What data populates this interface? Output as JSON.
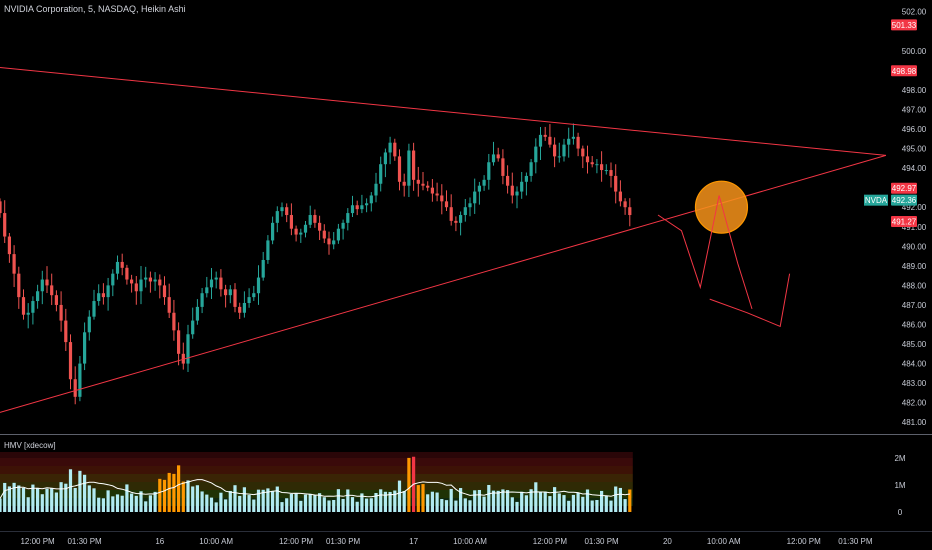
{
  "header": {
    "symbol_line": "NVIDIA Corporation, 5, NASDAQ, Heikin Ashi"
  },
  "indicator": {
    "label": "HMV [xdecow]"
  },
  "colors": {
    "up": "#26a69a",
    "down": "#ef5350",
    "line": "#f23645",
    "circle_fill": "#f7931a",
    "vol_light": "#b2ebf2",
    "vol_hot": "#ff9800",
    "vol_extreme": "#f23645",
    "avg_line": "#ffffff",
    "background": "#000000"
  },
  "chart_data": {
    "type": "candlestick",
    "symbol": "NVDA",
    "ylim": [
      480.5,
      502.6
    ],
    "y_ticks": [
      481,
      482,
      483,
      484,
      485,
      486,
      487,
      488,
      489,
      490,
      491,
      492,
      494,
      495,
      496,
      497,
      498,
      500,
      502
    ],
    "y_tick_labels": [
      "481.00",
      "482.00",
      "483.00",
      "484.00",
      "485.00",
      "486.00",
      "487.00",
      "488.00",
      "489.00",
      "490.00",
      "491.00",
      "492.00",
      "494.00",
      "495.00",
      "496.00",
      "497.00",
      "498.00",
      "500.00",
      "502.00"
    ],
    "price_tags": [
      {
        "label": "501.33",
        "value": 501.33,
        "color": "#f23645"
      },
      {
        "label": "498.98",
        "value": 498.98,
        "color": "#f23645"
      },
      {
        "label": "492.97",
        "value": 492.97,
        "color": "#f23645"
      },
      {
        "label": "492.36",
        "value": 492.36,
        "color": "#26a69a",
        "symbol_tag": "NVDA"
      },
      {
        "label": "491.27",
        "value": 491.27,
        "color": "#f23645"
      }
    ],
    "x_ticks": [
      {
        "label": "12:00 PM",
        "bar": 8
      },
      {
        "label": "01:30 PM",
        "bar": 18
      },
      {
        "label": "16",
        "bar": 34
      },
      {
        "label": "10:00 AM",
        "bar": 46
      },
      {
        "label": "12:00 PM",
        "bar": 63
      },
      {
        "label": "01:30 PM",
        "bar": 73
      },
      {
        "label": "17",
        "bar": 88
      },
      {
        "label": "10:00 AM",
        "bar": 100
      },
      {
        "label": "12:00 PM",
        "bar": 117
      },
      {
        "label": "01:30 PM",
        "bar": 128
      },
      {
        "label": "20",
        "bar": 142
      },
      {
        "label": "10:00 AM",
        "bar": 154
      },
      {
        "label": "12:00 PM",
        "bar": 171
      },
      {
        "label": "01:30 PM",
        "bar": 182
      }
    ],
    "closes": [
      491.7,
      490.5,
      489.6,
      488.6,
      487.4,
      486.5,
      486.6,
      487.2,
      487.7,
      488.3,
      488.0,
      487.5,
      487.0,
      486.2,
      485.1,
      483.2,
      482.3,
      484.0,
      485.6,
      486.4,
      487.2,
      487.6,
      487.4,
      488.0,
      488.6,
      489.2,
      488.9,
      488.3,
      488.1,
      487.7,
      488.3,
      488.4,
      488.2,
      488.3,
      488.0,
      487.4,
      486.6,
      485.7,
      484.5,
      484.0,
      485.5,
      486.2,
      486.9,
      487.6,
      487.9,
      488.3,
      488.4,
      487.8,
      487.5,
      487.8,
      486.9,
      486.6,
      487.1,
      487.4,
      487.6,
      488.4,
      489.3,
      490.3,
      491.2,
      491.8,
      492.0,
      491.6,
      490.9,
      490.6,
      490.7,
      491.1,
      491.6,
      491.2,
      490.8,
      490.4,
      490.1,
      490.3,
      490.9,
      491.2,
      491.7,
      492.1,
      491.9,
      492.1,
      492.2,
      492.6,
      493.2,
      494.2,
      494.8,
      495.3,
      494.6,
      493.3,
      493.1,
      494.9,
      493.4,
      493.2,
      493.1,
      493.0,
      492.7,
      492.6,
      492.3,
      492.0,
      491.3,
      491.2,
      491.6,
      492.0,
      492.2,
      492.8,
      493.1,
      493.4,
      494.3,
      494.7,
      494.5,
      493.6,
      493.1,
      492.6,
      492.8,
      493.3,
      493.6,
      494.3,
      495.1,
      495.7,
      495.6,
      495.2,
      494.6,
      494.6,
      495.2,
      495.5,
      495.6,
      495.0,
      494.6,
      494.3,
      494.2,
      494.2,
      493.9,
      493.9,
      493.6,
      492.8,
      492.3,
      492.0,
      491.6
    ],
    "volume": {
      "ylim": [
        0,
        2.3
      ],
      "y_tick_labels": [
        "0",
        "1M",
        "2M"
      ],
      "y_ticks": [
        0,
        1,
        2
      ]
    },
    "trendlines": [
      {
        "name": "upper",
        "from": [
          0,
          499.15
        ],
        "to": [
          188.5,
          494.65
        ]
      },
      {
        "name": "lower",
        "from": [
          0,
          481.5
        ],
        "to": [
          188.5,
          494.65
        ]
      }
    ],
    "annotations": [
      {
        "type": "circle",
        "center": [
          153.5,
          492.0
        ],
        "label": ""
      },
      {
        "type": "path",
        "points": [
          [
            140,
            491.6
          ],
          [
            145,
            490.8
          ],
          [
            149,
            487.9
          ],
          [
            153,
            492.6
          ],
          [
            157,
            489.1
          ],
          [
            160,
            486.8
          ]
        ]
      },
      {
        "type": "path",
        "points": [
          [
            151,
            487.3
          ],
          [
            159,
            486.6
          ],
          [
            166,
            485.9
          ],
          [
            168,
            488.6
          ]
        ]
      }
    ]
  }
}
